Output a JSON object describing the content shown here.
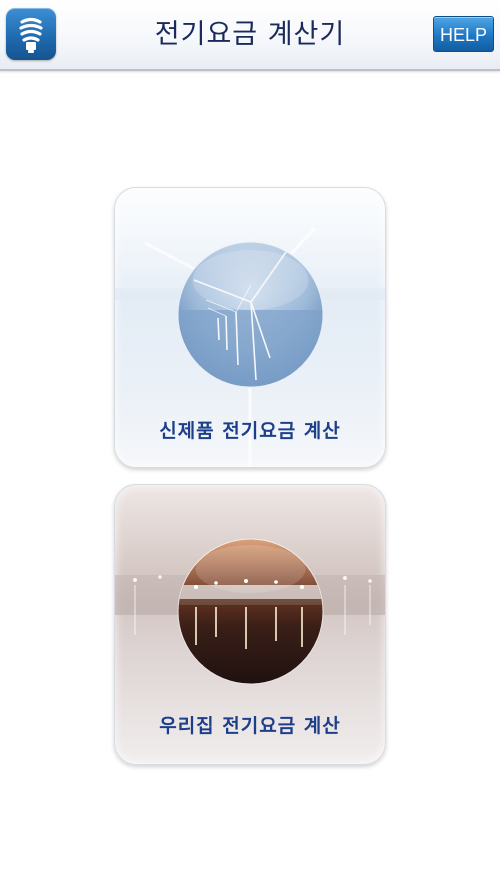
{
  "header": {
    "title": "전기요금 계산기",
    "help_label": "HELP",
    "app_icon": "lightbulb-icon"
  },
  "menu": {
    "items": [
      {
        "label": "신제품 전기요금 계산",
        "image": "wind-turbine-photo"
      },
      {
        "label": "우리집 전기요금 계산",
        "image": "night-harbor-photo"
      }
    ]
  },
  "colors": {
    "title": "#1b2a5c",
    "label": "#1d3f8a",
    "help_button": "#1f78c4",
    "app_icon": "#1e68ad"
  }
}
